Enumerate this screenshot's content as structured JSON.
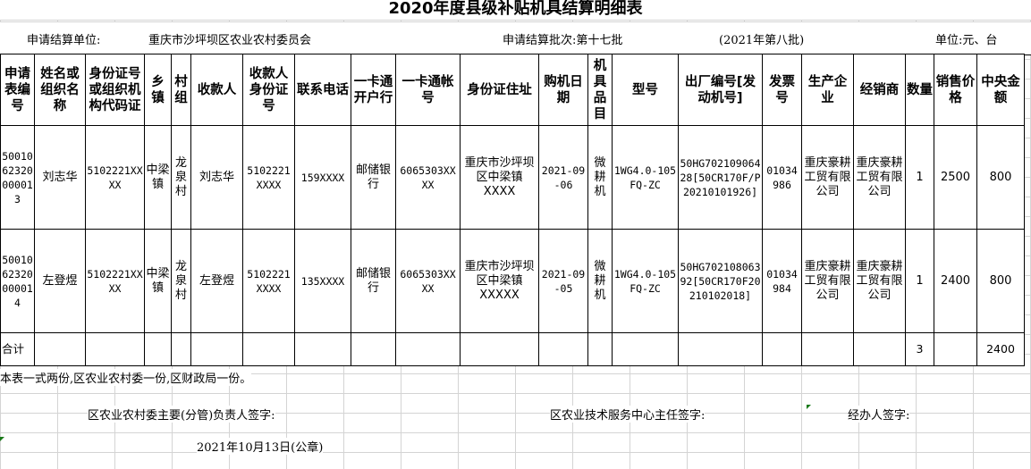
{
  "title": "2020年度县级补贴机具结算明细表",
  "header": {
    "unit_label": "申请结算单位:",
    "unit_value": "重庆市沙坪坝区农业农村委员会",
    "batch_label": "申请结算批次:第十七批",
    "batch_note": "(2021年第八批)",
    "currency": "单位:元、台"
  },
  "columns": [
    "申请表编号",
    "姓名或组织名称",
    "身份证号或组织机构代码证",
    "乡镇",
    "村组",
    "收款人",
    "收款人身份证号",
    "联系电话",
    "一卡通开户行",
    "一卡通帐号",
    "身份证住址",
    "购机日期",
    "机具品目",
    "型号",
    "出厂编号[发动机号]",
    "发票号",
    "生产企业",
    "经销商",
    "数量",
    "销售价格",
    "中央金额"
  ],
  "rows": [
    {
      "app_no": "5001062320000013",
      "name": "刘志华",
      "id_no": "5102221XXXX",
      "town": "中梁镇",
      "village": "龙泉村",
      "payee": "刘志华",
      "payee_id": "5102221XXXX",
      "phone": "159XXXX",
      "bank": "邮储银行",
      "account": "6065303XXXX",
      "address": "重庆市沙坪坝区中梁镇XXXX",
      "date": "2021-09-06",
      "category": "微耕机",
      "model": "1WG4.0-105FQ-ZC",
      "serial": "50HG70210906428[50CR170F/P20210101926]",
      "invoice": "01034986",
      "maker": "重庆豪耕工贸有限公司",
      "dealer": "重庆豪耕工贸有限公司",
      "qty": "1",
      "price": "2500",
      "central": "800"
    },
    {
      "app_no": "5001062320000014",
      "name": "左登煜",
      "id_no": "5102221XXXX",
      "town": "中梁镇",
      "village": "龙泉村",
      "payee": "左登煜",
      "payee_id": "5102221XXXX",
      "phone": "135XXXX",
      "bank": "邮储银行",
      "account": "6065303XXXX",
      "address": "重庆市沙坪坝区中梁镇XXXXX",
      "date": "2021-09-05",
      "category": "微耕机",
      "model": "1WG4.0-105FQ-ZC",
      "serial": "50HG70210806392[50CR170F20210102018]",
      "invoice": "01034984",
      "maker": "重庆豪耕工贸有限公司",
      "dealer": "重庆豪耕工贸有限公司",
      "qty": "1",
      "price": "2400",
      "central": "800"
    }
  ],
  "totals": {
    "label": "合计",
    "qty": "3",
    "central": "2400"
  },
  "note": "本表一式两份,区农业农村委一份,区财政局一份。",
  "signatures": {
    "agriculture": "区农业农村委主要(分管)负责人签字:",
    "tech_center": "区农业技术服务中心主任签字:",
    "handler": "经办人签字:"
  },
  "date_seal": "2021年10月13日(公章)"
}
